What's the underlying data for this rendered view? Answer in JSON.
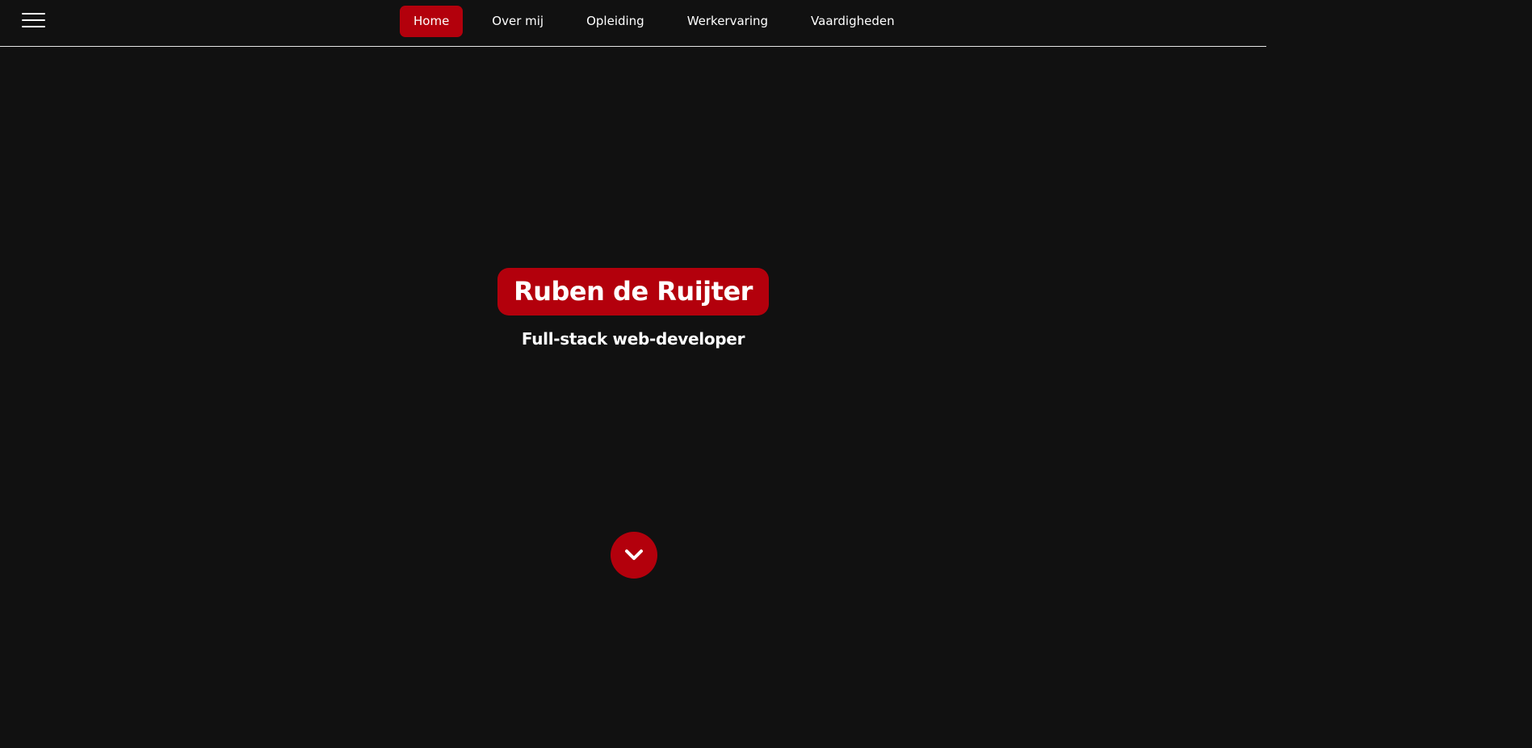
{
  "header": {
    "menu_icon": "hamburger-menu-icon",
    "nav": [
      {
        "label": "Home",
        "active": true
      },
      {
        "label": "Over mij",
        "active": false
      },
      {
        "label": "Opleiding",
        "active": false
      },
      {
        "label": "Werkervaring",
        "active": false
      },
      {
        "label": "Vaardigheden",
        "active": false
      }
    ]
  },
  "hero": {
    "name": "Ruben de Ruijter",
    "role": "Full-stack web-developer"
  },
  "scroll_button": {
    "icon": "chevron-down-icon"
  },
  "colors": {
    "accent": "#b3000c",
    "background": "#111111",
    "text": "#ffffff"
  }
}
